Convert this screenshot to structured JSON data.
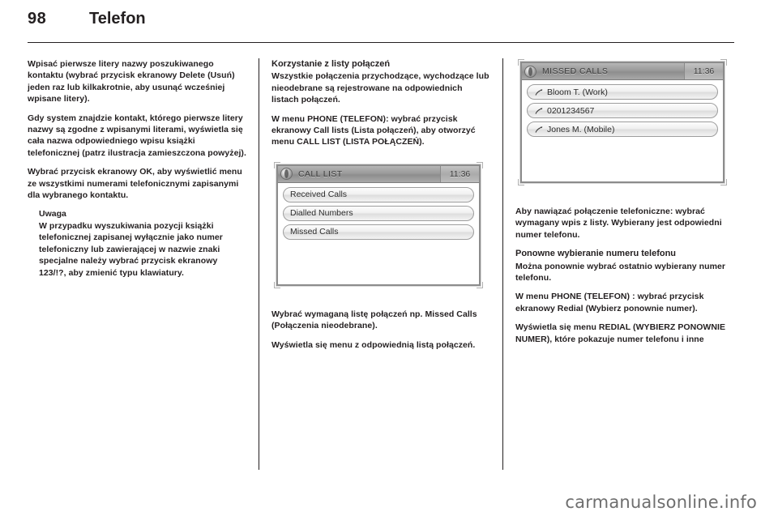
{
  "header": {
    "page_number": "98",
    "title": "Telefon"
  },
  "watermark": "carmanualsonline.info",
  "columns": {
    "left": {
      "p1": "Wpisać pierwsze litery nazwy poszukiwanego kontaktu (wybrać przycisk ekranowy Delete (Usuń) jeden raz lub kilkakrotnie, aby usunąć wcześniej wpisane litery).",
      "p2": "Gdy system znajdzie kontakt, którego pierwsze litery nazwy są zgodne z wpisanymi literami, wyświetla się cała nazwa odpowiedniego wpisu książki telefonicznej (patrz ilustracja zamieszczona powyżej).",
      "p3": "Wybrać przycisk ekranowy OK, aby wyświetlić menu ze wszystkimi numerami telefonicznymi zapisanymi dla wybranego kontaktu.",
      "note_title": "Uwaga",
      "note_body": "W przypadku wyszukiwania pozycji książki telefonicznej zapisanej wyłącznie jako numer telefoniczny lub zawierającej w nazwie znaki specjalne należy wybrać przycisk ekranowy 123/!?, aby zmienić typu klawiatury."
    },
    "middle": {
      "heading": "Korzystanie z listy połączeń",
      "p1": "Wszystkie połączenia przychodzące, wychodzące lub nieodebrane są rejestrowane na odpowiednich listach połączeń.",
      "p2": "W menu PHONE (TELEFON): wybrać przycisk ekranowy Call lists (Lista połączeń), aby otworzyć menu CALL LIST (LISTA POŁĄCZEŃ).",
      "p3": "Wybrać wymaganą listę połączeń np. Missed Calls (Połączenia nieodebrane).",
      "p4": "Wyświetla się menu z odpowiednią listą połączeń.",
      "figure": {
        "title": "CALL LIST",
        "clock": "11:36",
        "icon": "globe-icon",
        "items": [
          {
            "label": "Received Calls",
            "icon": "none"
          },
          {
            "label": "Dialled Numbers",
            "icon": "none"
          },
          {
            "label": "Missed Calls",
            "icon": "none"
          }
        ]
      }
    },
    "right": {
      "figure": {
        "title": "MISSED CALLS",
        "clock": "11:36",
        "icon": "globe-icon",
        "items": [
          {
            "label": "Bloom T. (Work)",
            "icon": "missed-call-icon"
          },
          {
            "label": "0201234567",
            "icon": "missed-call-icon"
          },
          {
            "label": "Jones M. (Mobile)",
            "icon": "missed-call-icon"
          }
        ]
      },
      "p1": "Aby nawiązać połączenie telefoniczne: wybrać wymagany wpis z listy. Wybierany jest odpowiedni numer telefonu.",
      "heading": "Ponowne wybieranie numeru telefonu",
      "p2": "Można ponownie wybrać ostatnio wybierany numer telefonu.",
      "p3": "W menu PHONE (TELEFON) : wybrać przycisk ekranowy Redial (Wybierz ponownie numer).",
      "p4": "Wyświetla się menu REDIAL (WYBIERZ PONOWNIE NUMER), które pokazuje numer telefonu i inne"
    }
  }
}
